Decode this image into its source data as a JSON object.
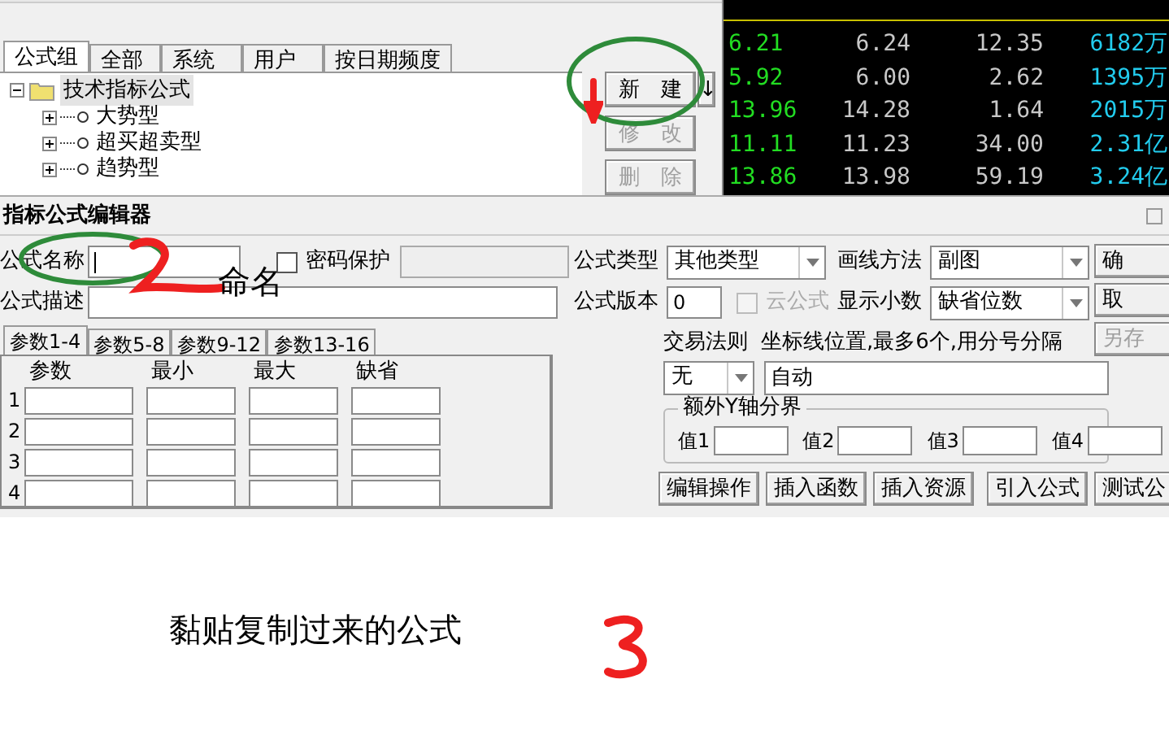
{
  "formula_manager": {
    "tabs": [
      {
        "label": "公式组",
        "selected": true
      },
      {
        "label": "全部",
        "selected": false
      },
      {
        "label": "系统",
        "selected": false
      },
      {
        "label": "用户",
        "selected": false
      },
      {
        "label": "按日期频度",
        "selected": false
      }
    ],
    "tree": {
      "label": "技术指标公式",
      "expanded": true,
      "selected": true,
      "children": [
        {
          "label": "大势型",
          "expanded": false,
          "selected": false
        },
        {
          "label": "超买超卖型",
          "expanded": false,
          "selected": false
        },
        {
          "label": "趋势型",
          "expanded": false,
          "selected": false
        }
      ]
    },
    "buttons": [
      {
        "label": "新　建",
        "disabled": false
      },
      {
        "label": "修　改",
        "disabled": true
      },
      {
        "label": "删　除",
        "disabled": true
      }
    ],
    "menu_arrow": "↓"
  },
  "quotes": {
    "rows": [
      {
        "cells": [
          "6.21",
          "6.24",
          "12.35",
          "6182万"
        ]
      },
      {
        "cells": [
          "5.92",
          "6.00",
          "2.62",
          "1395万"
        ]
      },
      {
        "cells": [
          "13.96",
          "14.28",
          "1.64",
          "2015万"
        ]
      },
      {
        "cells": [
          "11.11",
          "11.23",
          "34.00",
          "2.31亿"
        ]
      },
      {
        "cells": [
          "13.86",
          "13.98",
          "59.19",
          "3.24亿"
        ]
      }
    ]
  },
  "editor": {
    "title": "指标公式编辑器",
    "name_field": {
      "label": "公式名称"
    },
    "password": {
      "label": "密码保护",
      "checked": false
    },
    "description": {
      "label": "公式描述"
    },
    "formula_type": {
      "label": "公式类型",
      "value": "其他类型"
    },
    "draw_method": {
      "label": "画线方法",
      "value": "副图"
    },
    "version": {
      "label": "公式版本",
      "value": "0"
    },
    "cloud": {
      "label": "云公式",
      "checked": false,
      "disabled": true
    },
    "decimals": {
      "label": "显示小数",
      "value": "缺省位数"
    },
    "param_tabs": [
      {
        "label": "参数1-4",
        "selected": true
      },
      {
        "label": "参数5-8",
        "selected": false
      },
      {
        "label": "参数9-12",
        "selected": false
      },
      {
        "label": "参数13-16",
        "selected": false
      }
    ],
    "param_columns": [
      "参数",
      "最小",
      "最大",
      "缺省"
    ],
    "param_rows": [
      "1",
      "2",
      "3",
      "4"
    ],
    "trade_rule": {
      "label": "交易法则",
      "value": "无"
    },
    "axis_lines": {
      "label": "坐标线位置,最多6个,用分号分隔",
      "value": "自动"
    },
    "extra_y": {
      "title": "额外Y轴分界",
      "fields": [
        "值1",
        "值2",
        "值3",
        "值4"
      ]
    },
    "action_buttons": [
      "编辑操作",
      "插入函数",
      "插入资源",
      "引入公式",
      "测试公"
    ],
    "side_buttons": [
      {
        "label": "确",
        "disabled": false
      },
      {
        "label": "取",
        "disabled": false
      },
      {
        "label": "另存",
        "disabled": true
      }
    ]
  },
  "annotations": {
    "name_note": "命名",
    "paste_note": "黏贴复制过来的公式"
  }
}
